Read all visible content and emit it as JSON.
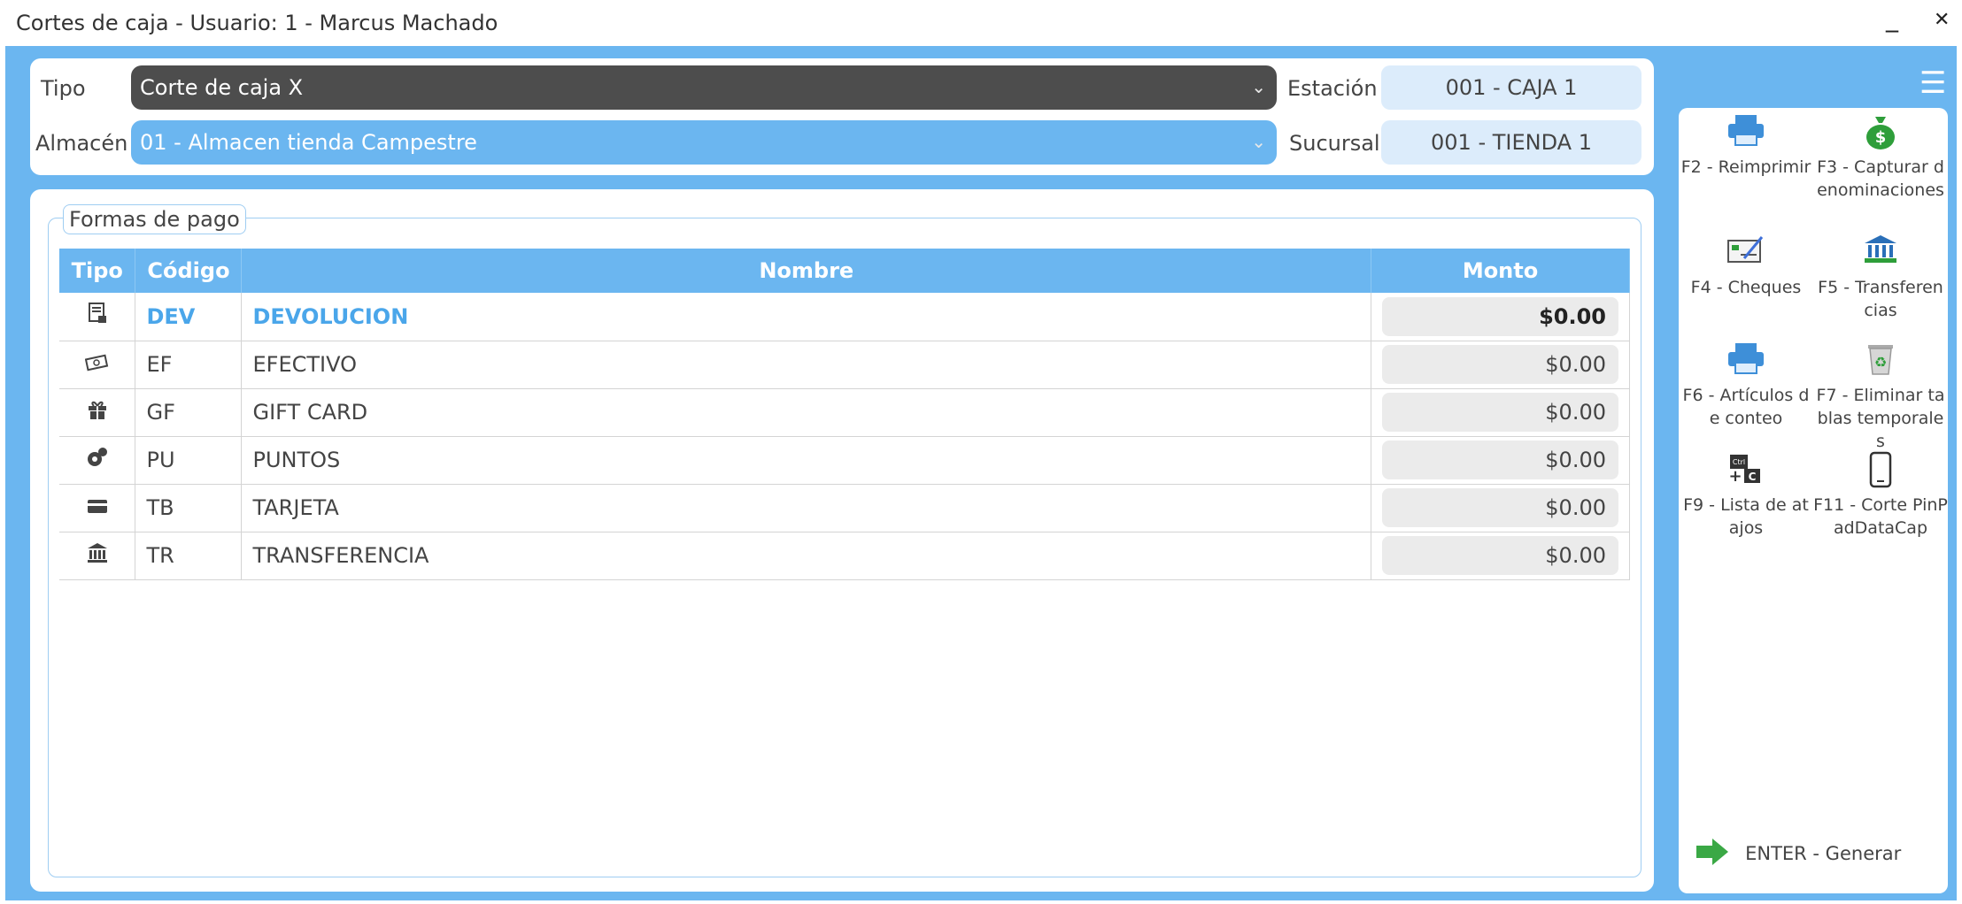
{
  "window": {
    "title": "Cortes de caja - Usuario: 1 - Marcus  Machado",
    "minimize": "_",
    "close": "✕"
  },
  "form": {
    "tipo_label": "Tipo",
    "tipo_value": "Corte de caja X",
    "almacen_label": "Almacén",
    "almacen_value": "01 - Almacen tienda Campestre",
    "estacion_label": "Estación",
    "estacion_value": "001 - CAJA 1",
    "sucursal_label": "Sucursal",
    "sucursal_value": "001 - TIENDA 1"
  },
  "formas_pago": {
    "legend": "Formas de pago",
    "columns": [
      "Tipo",
      "Código",
      "Nombre",
      "Monto"
    ],
    "rows": [
      {
        "icon": "receipt-icon",
        "codigo": "DEV",
        "nombre": "DEVOLUCION",
        "monto": "$0.00"
      },
      {
        "icon": "cash-icon",
        "codigo": "EF",
        "nombre": "EFECTIVO",
        "monto": "$0.00"
      },
      {
        "icon": "gift-icon",
        "codigo": "GF",
        "nombre": "GIFT CARD",
        "monto": "$0.00"
      },
      {
        "icon": "coins-icon",
        "codigo": "PU",
        "nombre": "PUNTOS",
        "monto": "$0.00"
      },
      {
        "icon": "card-icon",
        "codigo": "TB",
        "nombre": "TARJETA",
        "monto": "$0.00"
      },
      {
        "icon": "bank-icon",
        "codigo": "TR",
        "nombre": "TRANSFERENCIA",
        "monto": "$0.00"
      }
    ]
  },
  "sidebar": {
    "actions": [
      {
        "icon": "printer-icon",
        "label": "F2 - Reimprimir"
      },
      {
        "icon": "money-bag-icon",
        "label": "F3 - Capturar denominaciones"
      },
      {
        "icon": "check-icon",
        "label": "F4 - Cheques"
      },
      {
        "icon": "bank-icon",
        "label": "F5 - Transferencias"
      },
      {
        "icon": "printer-icon",
        "label": "F6 - Artículos de conteo"
      },
      {
        "icon": "recycle-bin-icon",
        "label": "F7 - Eliminar tablas temporales"
      },
      {
        "icon": "keyboard-shortcut-icon",
        "label": "F9 - Lista de atajos"
      },
      {
        "icon": "phone-icon",
        "label": "F11 - Corte PinPadDataCap"
      }
    ],
    "enter": {
      "icon": "arrow-right-icon",
      "label": "ENTER - Generar"
    }
  },
  "colors": {
    "accent": "#6bb6f0",
    "dark_select": "#4d4d4d",
    "highlight_text": "#4aa6ea"
  }
}
